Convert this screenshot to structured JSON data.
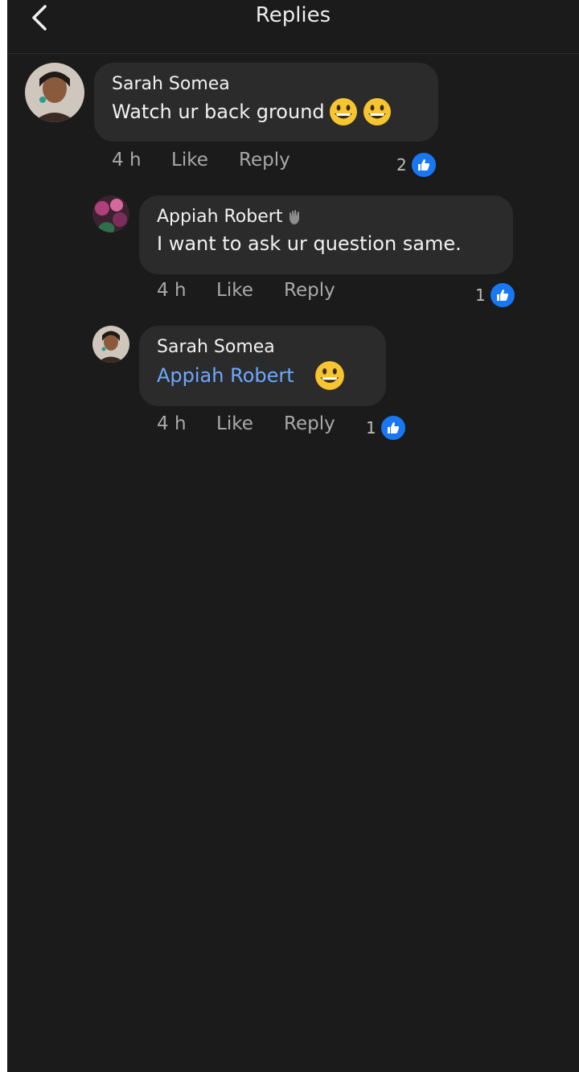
{
  "header": {
    "title": "Replies",
    "back_icon": "chevron-left-icon"
  },
  "colors": {
    "background": "#1b1b1b",
    "bubble": "#2b2b2b",
    "mention": "#6ea8fe",
    "like_badge": "#1877f2"
  },
  "comments": [
    {
      "author": "Sarah Somea",
      "text": "Watch ur back ground",
      "emojis": [
        "grinning-face",
        "grinning-face"
      ],
      "time": "4 h",
      "like_label": "Like",
      "reply_label": "Reply",
      "like_count": "2"
    },
    {
      "author": "Appiah Robert",
      "author_badge": "waving-hand-icon",
      "text": "I want to ask ur question same.",
      "time": "4 h",
      "like_label": "Like",
      "reply_label": "Reply",
      "like_count": "1"
    },
    {
      "author": "Sarah Somea",
      "mention": "Appiah Robert",
      "emojis": [
        "grinning-face"
      ],
      "time": "4 h",
      "like_label": "Like",
      "reply_label": "Reply",
      "like_count": "1"
    }
  ]
}
